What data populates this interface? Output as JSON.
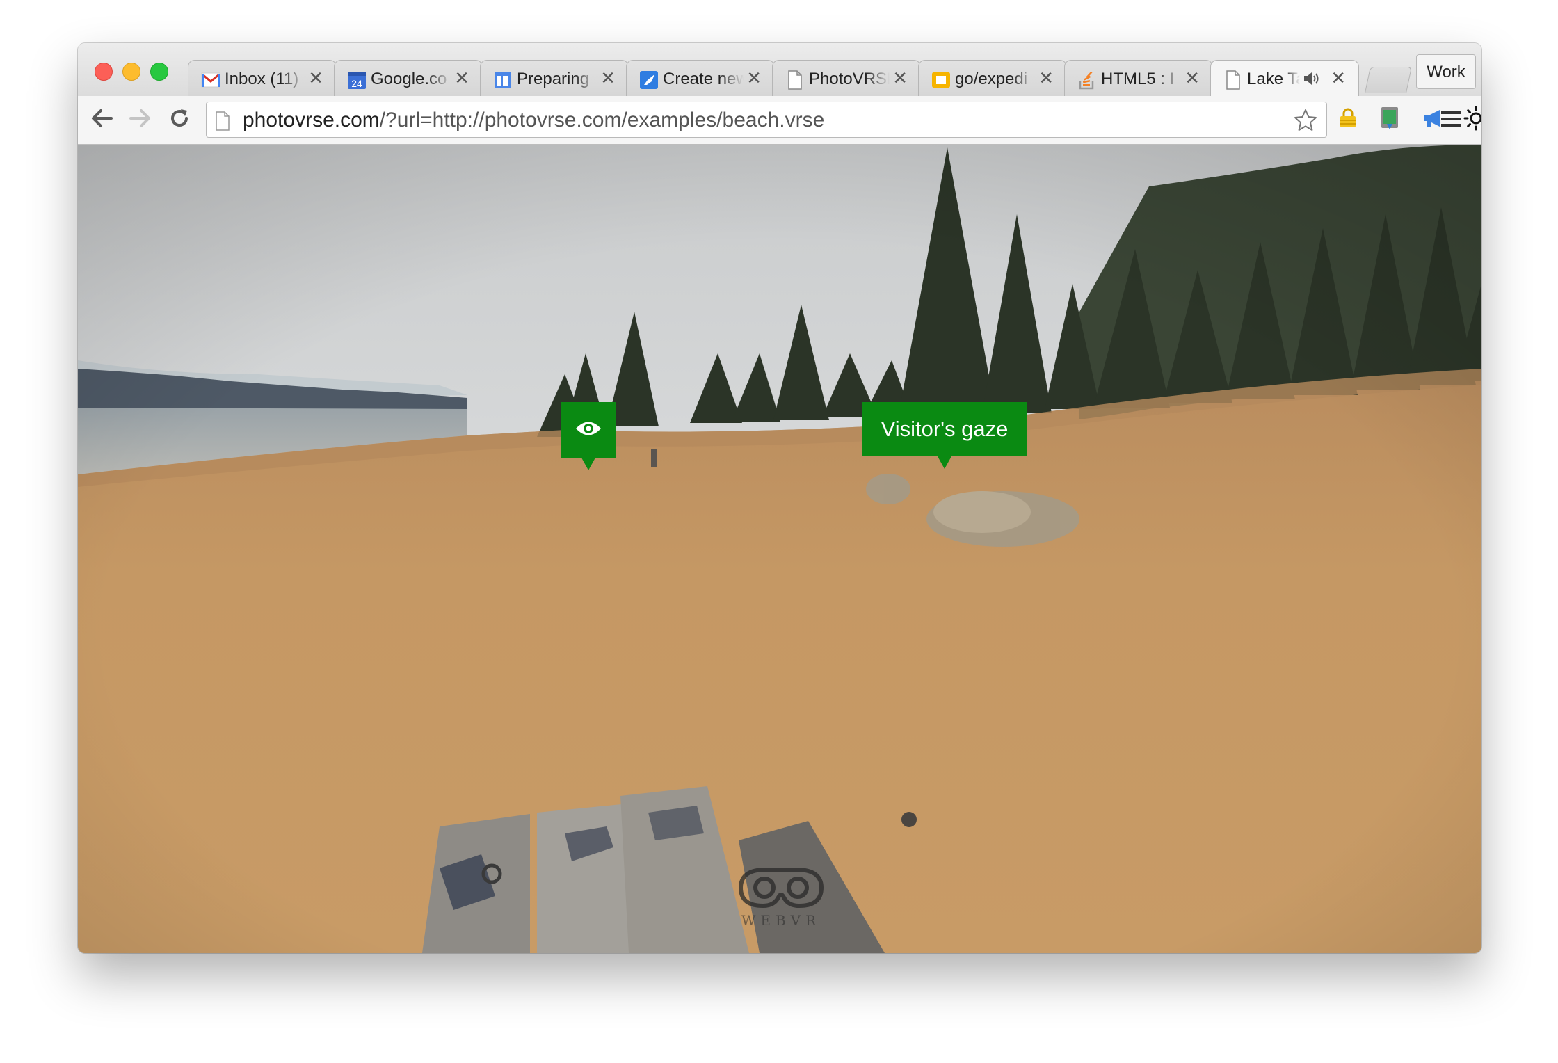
{
  "window": {
    "tabs": [
      {
        "title": "Inbox (11)",
        "icon": "gmail-icon",
        "active": false
      },
      {
        "title": "Google.co",
        "icon": "calendar-icon",
        "badge": "24",
        "active": false
      },
      {
        "title": "Preparing",
        "icon": "slides-icon",
        "active": false
      },
      {
        "title": "Create new",
        "icon": "rocket-icon",
        "active": false
      },
      {
        "title": "PhotoVRSE",
        "icon": "page-icon",
        "active": false
      },
      {
        "title": "go/expedi",
        "icon": "shortlink-icon",
        "active": false
      },
      {
        "title": "HTML5 : I",
        "icon": "stackoverflow-icon",
        "active": false
      },
      {
        "title": "Lake Ta",
        "icon": "page-icon",
        "active": true,
        "audio": true
      }
    ],
    "close_glyph": "✕",
    "profile": "Work"
  },
  "toolbar": {
    "url_host": "photovrse.com",
    "url_rest": "/?url=http://photovrse.com/examples/beach.vrse"
  },
  "viewer": {
    "hotspot_gaze_label": "Visitor's gaze",
    "webvr_label": "WEBVR"
  },
  "colors": {
    "hotspot_green": "#0a8a12",
    "sand": "#c79a62",
    "sky": "#d9dbdc"
  }
}
